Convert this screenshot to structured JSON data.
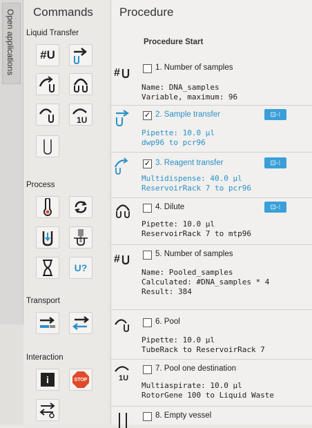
{
  "side_tab": {
    "label": "Open applications"
  },
  "commands": {
    "title": "Commands",
    "categories": {
      "liquid_transfer": "Liquid Transfer",
      "process": "Process",
      "transport": "Transport",
      "interaction": "Interaction"
    },
    "buttons": {
      "number_of_samples": "number-of-samples-icon",
      "sample_transfer": "sample-transfer-icon",
      "reagent_transfer": "reagent-transfer-icon",
      "dilute": "dilute-icon",
      "pool": "pool-icon",
      "pool_one_destination": "pool-one-destination-icon",
      "empty_vessel": "empty-vessel-icon",
      "temperature": "thermometer-icon",
      "shake": "shake-icon",
      "centrifuge": "centrifuge-icon",
      "aspirate_tip": "aspirate-tip-icon",
      "wait": "hourglass-icon",
      "query": "query-icon",
      "move": "move-icon",
      "swap": "swap-icon",
      "info": "info-icon",
      "stop": "stop-icon",
      "settings": "settings-icon",
      "stop_label": "STOP",
      "info_label": "i",
      "query_label": "U?",
      "hash_label": "#U",
      "empty_label": "U"
    }
  },
  "procedure": {
    "title": "Procedure",
    "start": "Procedure Start",
    "steps": [
      {
        "checked": false,
        "title": "1. Number of samples",
        "lines": [
          "Name: DNA_samples",
          "Variable, maximum: 96"
        ],
        "blue": false,
        "badge": false
      },
      {
        "checked": true,
        "title": "2. Sample transfer",
        "lines": [
          "Pipette: 10.0 µl",
          "dwp96 to pcr96"
        ],
        "blue": true,
        "badge": true
      },
      {
        "checked": true,
        "title": "3. Reagent transfer",
        "lines": [
          "Multidispense: 40.0 µl",
          "ReservoirRack 7 to pcr96"
        ],
        "blue": true,
        "badge": true
      },
      {
        "checked": false,
        "title": "4. Dilute",
        "lines": [
          "Pipette: 10.0 µl",
          "ReservoirRack 7 to mtp96"
        ],
        "blue": false,
        "badge": true
      },
      {
        "checked": false,
        "title": "5. Number of samples",
        "lines": [
          "Name: Pooled_samples",
          "Calculated: #DNA_samples * 4",
          "Result: 384"
        ],
        "blue": false,
        "badge": false
      },
      {
        "checked": false,
        "title": "6. Pool",
        "lines": [
          "Pipette: 10.0 µl",
          "TubeRack to ReservoirRack 7"
        ],
        "blue": false,
        "badge": false
      },
      {
        "checked": false,
        "title": "7. Pool one destination",
        "lines": [
          "Multiaspirate: 10.0 µl",
          "RotorGene 100 to Liquid Waste"
        ],
        "blue": false,
        "badge": false
      },
      {
        "checked": false,
        "title": "8. Empty vessel",
        "lines": [],
        "blue": false,
        "badge": false
      }
    ],
    "check_mark": "✓",
    "badge_label": "⊡-⁝"
  },
  "colors": {
    "accent_blue": "#2b90c9",
    "badge_blue": "#3a9fd8",
    "stop_red": "#e04a2a"
  }
}
